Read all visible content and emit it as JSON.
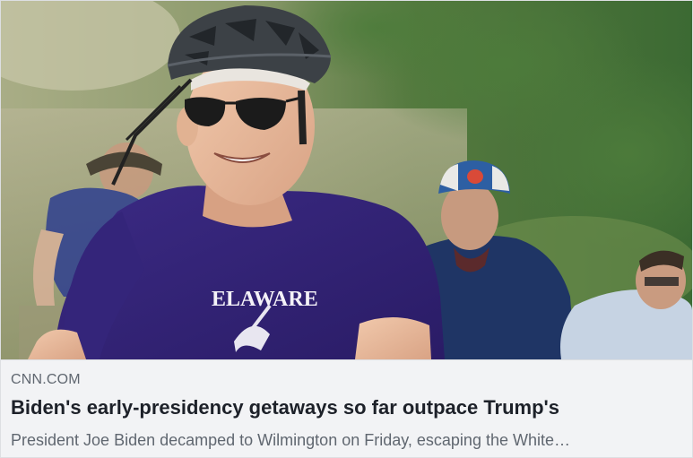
{
  "link_preview": {
    "domain": "CNN.COM",
    "headline": "Biden's early-presidency getaways so far outpace Trump's",
    "description": "President Joe Biden decamped to Wilmington on Friday, escaping the White…",
    "shirt_text": "ELAWARE"
  },
  "colors": {
    "card_background": "#f2f3f5",
    "card_border": "#dddfe2",
    "domain_text": "#606770",
    "headline_text": "#1d2129",
    "description_text": "#606770"
  }
}
